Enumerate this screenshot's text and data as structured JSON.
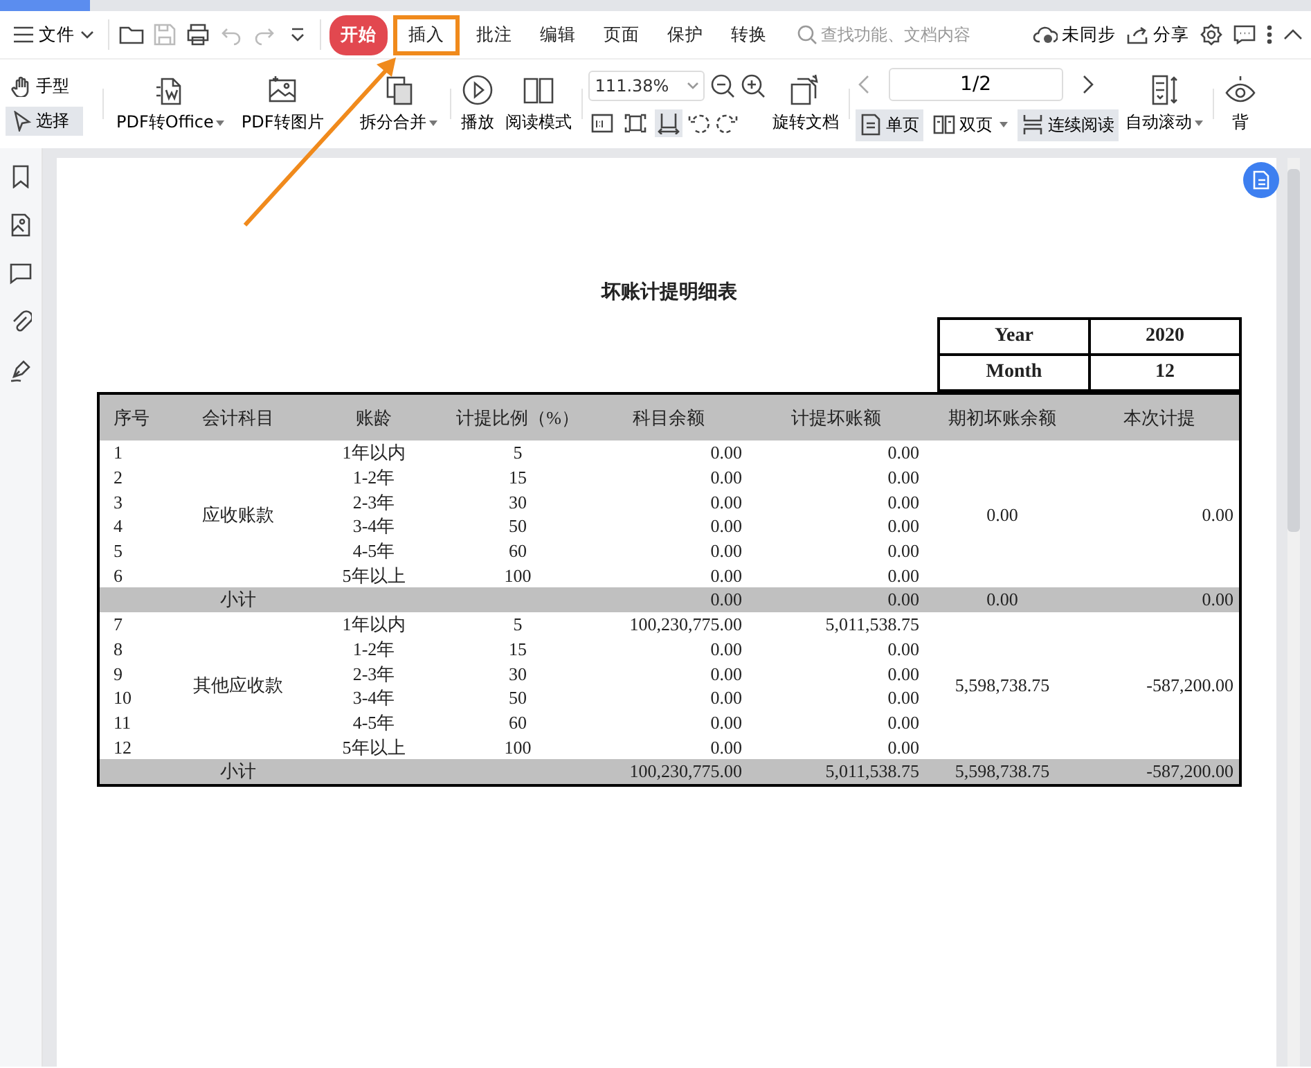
{
  "menu_bar": {
    "file_label": "文件",
    "tabs": [
      {
        "label": "开始",
        "selected": true,
        "highlighted": false
      },
      {
        "label": "插入",
        "selected": false,
        "highlighted": true
      },
      {
        "label": "批注",
        "selected": false,
        "highlighted": false
      },
      {
        "label": "编辑",
        "selected": false,
        "highlighted": false
      },
      {
        "label": "页面",
        "selected": false,
        "highlighted": false
      },
      {
        "label": "保护",
        "selected": false,
        "highlighted": false
      },
      {
        "label": "转换",
        "selected": false,
        "highlighted": false
      }
    ],
    "search": {
      "placeholder": "查找功能、文档内容"
    },
    "sync_label": "未同步",
    "share_label": "分享"
  },
  "toolbar": {
    "tools": [
      {
        "label": "手型",
        "selected": false
      },
      {
        "label": "选择",
        "selected": true
      }
    ],
    "convert_buttons": [
      {
        "label": "PDF转Office",
        "dropdown": true
      },
      {
        "label": "PDF转图片",
        "dropdown": false
      },
      {
        "label": "拆分合并",
        "dropdown": true
      }
    ],
    "view_buttons": [
      {
        "label": "播放"
      },
      {
        "label": "阅读模式"
      }
    ],
    "zoom": {
      "value": "111.38%"
    },
    "fit_buttons": [
      {
        "selected": false
      },
      {
        "selected": false
      },
      {
        "selected": true
      }
    ],
    "rotate_label": "旋转文档",
    "page_field": {
      "value": "1/2"
    },
    "layouts": [
      {
        "label": "单页",
        "selected": true,
        "dropdown": false
      },
      {
        "label": "双页",
        "selected": false,
        "dropdown": true
      },
      {
        "label": "连续阅读",
        "selected": true,
        "dropdown": false
      }
    ],
    "auto_scroll": {
      "label": "自动滚动",
      "dropdown": true
    },
    "background_label": "背"
  },
  "document": {
    "title": "坏账计提明细表",
    "period": [
      {
        "label": "Year",
        "value": "2020"
      },
      {
        "label": "Month",
        "value": "12"
      }
    ],
    "table": {
      "columns": [
        "序号",
        "会计科目",
        "账龄",
        "计提比例（%）",
        "科目余额",
        "计提坏账额",
        "期初坏账余额",
        "本次计提"
      ],
      "groups": [
        {
          "account": "应收账款",
          "opening": "0.00",
          "current": "0.00",
          "rows": [
            {
              "no": "1",
              "age": "1年以内",
              "ratio": "5",
              "balance": "0.00",
              "provision": "0.00"
            },
            {
              "no": "2",
              "age": "1-2年",
              "ratio": "15",
              "balance": "0.00",
              "provision": "0.00"
            },
            {
              "no": "3",
              "age": "2-3年",
              "ratio": "30",
              "balance": "0.00",
              "provision": "0.00"
            },
            {
              "no": "4",
              "age": "3-4年",
              "ratio": "50",
              "balance": "0.00",
              "provision": "0.00"
            },
            {
              "no": "5",
              "age": "4-5年",
              "ratio": "60",
              "balance": "0.00",
              "provision": "0.00"
            },
            {
              "no": "6",
              "age": "5年以上",
              "ratio": "100",
              "balance": "0.00",
              "provision": "0.00"
            }
          ],
          "subtotal": {
            "label": "小计",
            "balance": "0.00",
            "provision": "0.00",
            "opening": "0.00",
            "current": "0.00"
          }
        },
        {
          "account": "其他应收款",
          "opening": "5,598,738.75",
          "current": "-587,200.00",
          "rows": [
            {
              "no": "7",
              "age": "1年以内",
              "ratio": "5",
              "balance": "100,230,775.00",
              "provision": "5,011,538.75"
            },
            {
              "no": "8",
              "age": "1-2年",
              "ratio": "15",
              "balance": "0.00",
              "provision": "0.00"
            },
            {
              "no": "9",
              "age": "2-3年",
              "ratio": "30",
              "balance": "0.00",
              "provision": "0.00"
            },
            {
              "no": "10",
              "age": "3-4年",
              "ratio": "50",
              "balance": "0.00",
              "provision": "0.00"
            },
            {
              "no": "11",
              "age": "4-5年",
              "ratio": "60",
              "balance": "0.00",
              "provision": "0.00"
            },
            {
              "no": "12",
              "age": "5年以上",
              "ratio": "100",
              "balance": "0.00",
              "provision": "0.00"
            }
          ],
          "subtotal": {
            "label": "小计",
            "balance": "100,230,775.00",
            "provision": "5,011,538.75",
            "opening": "5,598,738.75",
            "current": "-587,200.00"
          }
        }
      ]
    }
  }
}
